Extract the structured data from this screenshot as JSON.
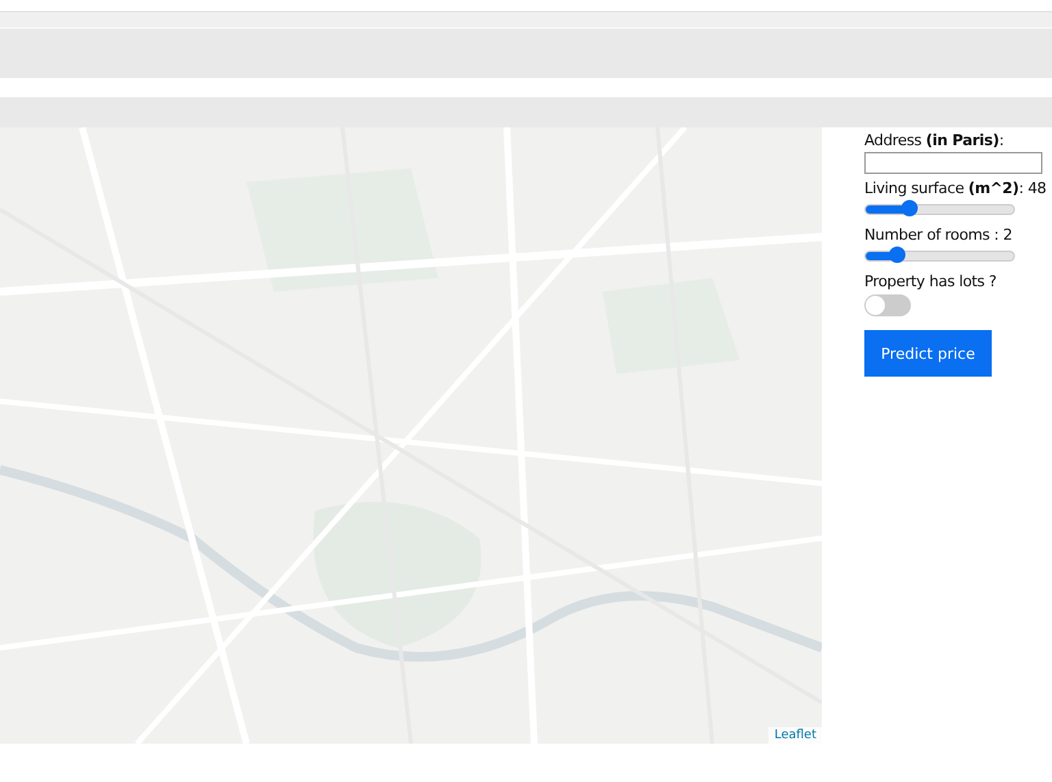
{
  "map": {
    "kind": "picture",
    "attribution": "Leaflet"
  },
  "form": {
    "address": {
      "label": "Address **(in Paris)**:"
    },
    "surface": {
      "label": "Living surface **(m^2)**: 48",
      "level": 0.3
    },
    "rooms": {
      "label": "Number of rooms : 2",
      "level": 0.21
    },
    "lots": {
      "label": "Property has lots ?",
      "on": false
    },
    "button": "Predict price"
  }
}
